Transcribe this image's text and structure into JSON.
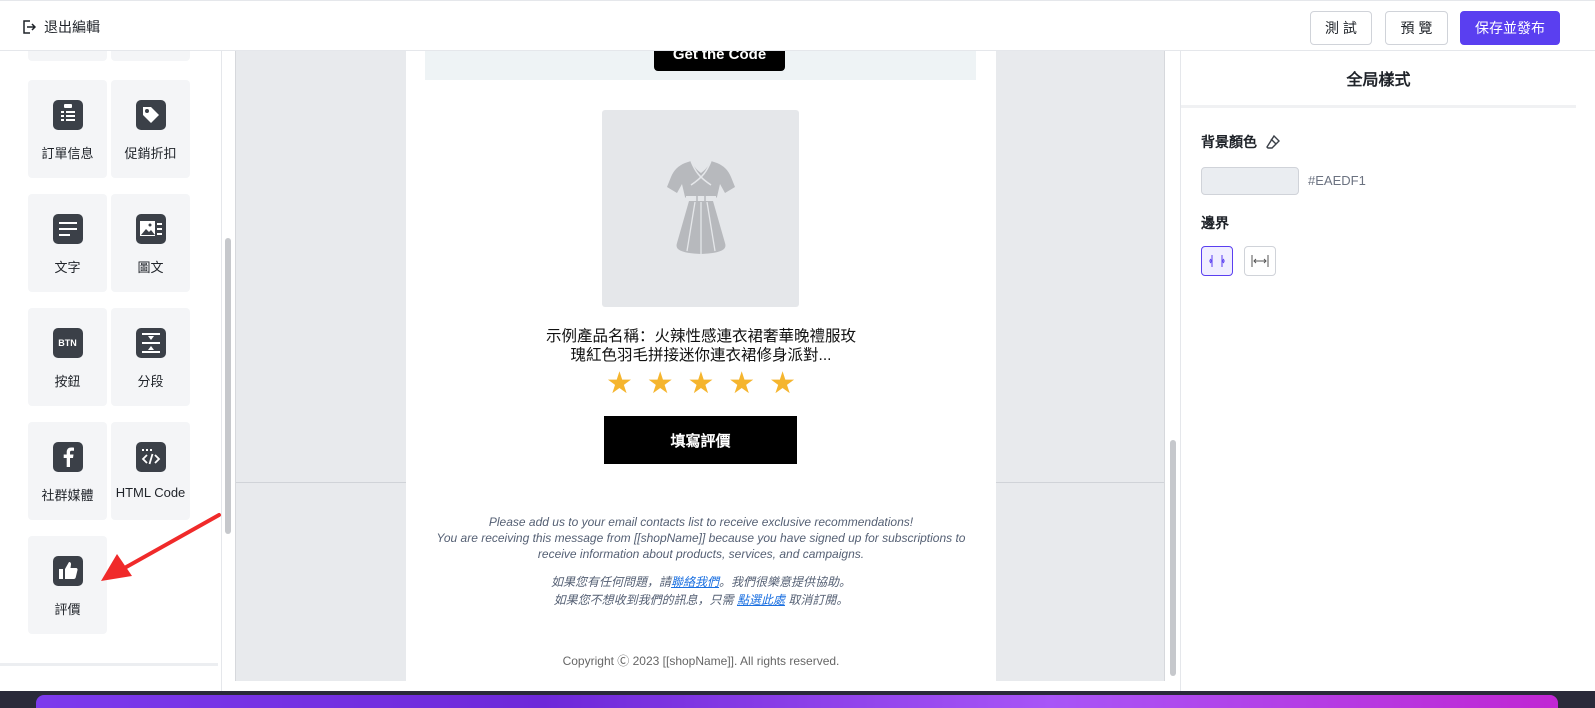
{
  "topbar": {
    "exit_label": "退出編輯",
    "test_label": "測 試",
    "preview_label": "預 覽",
    "save_label": "保存並發布"
  },
  "left_panel": {
    "tiles": [
      {
        "label": "訂單信息",
        "icon": "clipboard-list-icon"
      },
      {
        "label": "促銷折扣",
        "icon": "tag-icon"
      },
      {
        "label": "文字",
        "icon": "text-icon"
      },
      {
        "label": "圖文",
        "icon": "image-text-icon"
      },
      {
        "label": "按鈕",
        "icon": "button-icon",
        "icon_text": "BTN"
      },
      {
        "label": "分段",
        "icon": "divider-icon"
      },
      {
        "label": "社群媒體",
        "icon": "facebook-icon"
      },
      {
        "label": "HTML Code",
        "icon": "code-icon"
      },
      {
        "label": "評價",
        "icon": "thumbs-up-icon"
      }
    ]
  },
  "email": {
    "get_code_label": "Get the Code",
    "product_name": "示例產品名稱：火辣性感連衣裙奢華晚禮服玫瑰紅色羽毛拼接迷你連衣裙修身派對...",
    "product_name_line1": "示例產品名稱：火辣性感連衣裙奢華晚禮服玫",
    "product_name_line2": "瑰紅色羽毛拼接迷你連衣裙修身派對...",
    "rating": 5,
    "review_button": "填寫評價",
    "footer_line1": "Please add us to your email contacts list to receive exclusive recommendations!",
    "footer_line2": "You are receiving this message from [[shopName]] because you have signed up for subscriptions to receive information about products, services, and campaigns.",
    "help_prefix": "如果您有任何問題，請",
    "help_link": "聯絡我們",
    "help_suffix": "。我們很樂意提供協助。",
    "unsub_prefix": "如果您不想收到我們的訊息，只需 ",
    "unsub_link": "點選此處",
    "unsub_suffix": " 取消訂閱。",
    "copyright": "Copyright Ⓒ 2023 [[shopName]]. All rights reserved."
  },
  "right_panel": {
    "title": "全局樣式",
    "bg_color_label": "背景顏色",
    "bg_color_value": "#EAEDF1",
    "border_label": "邊界"
  },
  "colors": {
    "accent": "#5A3FF0",
    "email_bg": "#EAEDF1",
    "star": "#F5B52E",
    "arrow": "#F02A2A"
  }
}
